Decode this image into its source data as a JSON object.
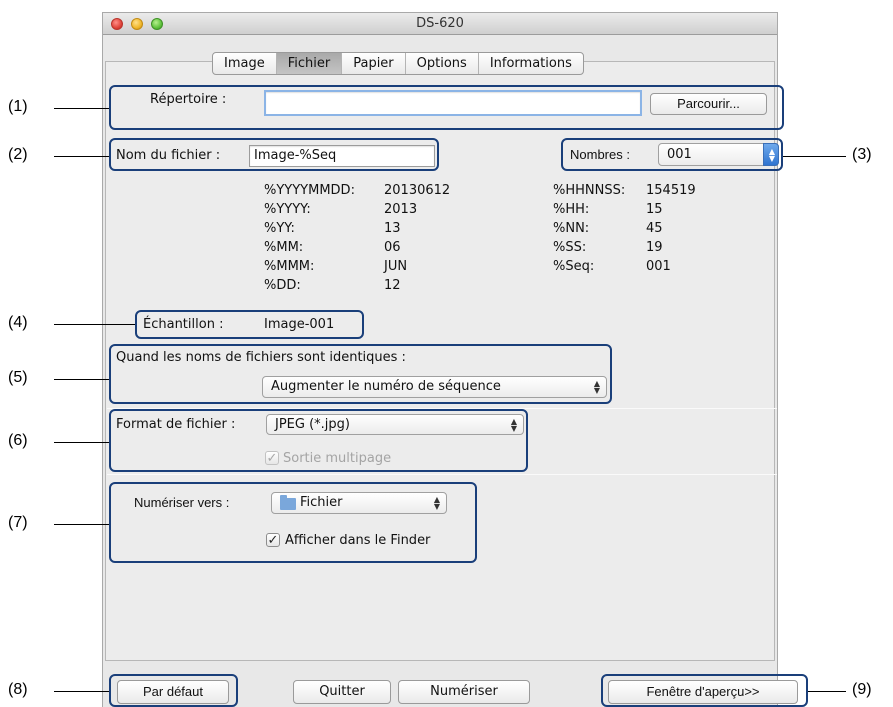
{
  "window": {
    "title": "DS-620"
  },
  "tabs": [
    "Image",
    "Fichier",
    "Papier",
    "Options",
    "Informations"
  ],
  "directory": {
    "label": "Répertoire :",
    "value": "",
    "browse_button": "Parcourir..."
  },
  "file_name": {
    "label": "Nom du fichier :",
    "value": "Image-%Seq"
  },
  "numbers": {
    "label": "Nombres :",
    "value": "001"
  },
  "variables_left": [
    {
      "key": "%YYYYMMDD:",
      "value": "20130612"
    },
    {
      "key": "%YYYY:",
      "value": "2013"
    },
    {
      "key": "%YY:",
      "value": "13"
    },
    {
      "key": "%MM:",
      "value": "06"
    },
    {
      "key": "%MMM:",
      "value": "JUN"
    },
    {
      "key": "%DD:",
      "value": "12"
    }
  ],
  "variables_right": [
    {
      "key": "%HHNNSS:",
      "value": "154519"
    },
    {
      "key": "%HH:",
      "value": "15"
    },
    {
      "key": "%NN:",
      "value": "45"
    },
    {
      "key": "%SS:",
      "value": "19"
    },
    {
      "key": "%Seq:",
      "value": "001"
    }
  ],
  "sample": {
    "label": "Échantillon :",
    "value": "Image-001"
  },
  "identical_names": {
    "label": "Quand les noms de fichiers sont identiques :",
    "value": "Augmenter le numéro de séquence"
  },
  "file_format": {
    "label": "Format de fichier :",
    "value": "JPEG (*.jpg)",
    "multipage_label": "Sortie multipage",
    "multipage_check": "✓"
  },
  "scan_to": {
    "label": "Numériser vers :",
    "value": "Fichier",
    "finder_label": "Afficher dans le Finder",
    "finder_check": "✓"
  },
  "buttons": {
    "default": "Par défaut",
    "quit": "Quitter",
    "scan": "Numériser",
    "preview": "Fenêtre d'aperçu>>"
  },
  "callouts": [
    "(1)",
    "(2)",
    "(3)",
    "(4)",
    "(5)",
    "(6)",
    "(7)",
    "(8)",
    "(9)"
  ],
  "colors": {
    "highlight": "#1a3f7a",
    "accent_blue": "#2f74d0"
  }
}
